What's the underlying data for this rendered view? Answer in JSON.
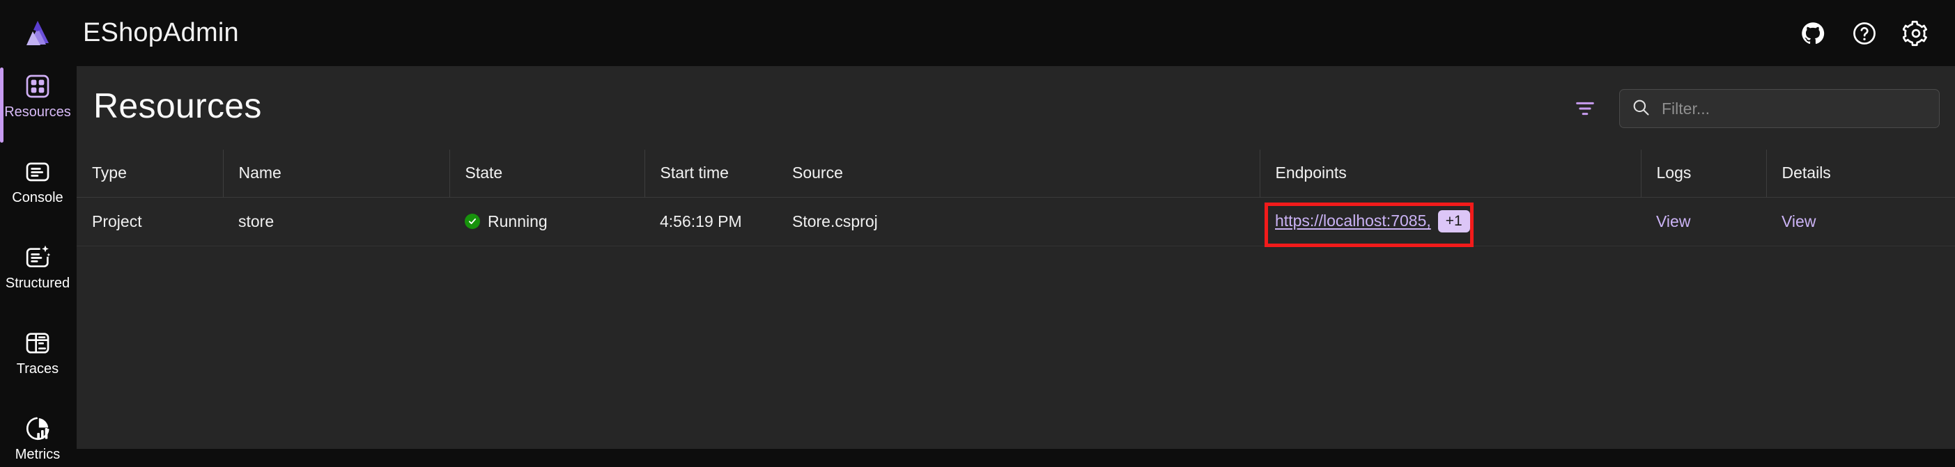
{
  "app": {
    "title": "EShopAdmin",
    "logo_icon": "aspire-logo-icon",
    "accent_color": "#c79bf0",
    "link_color": "#cbb3f5",
    "running_color": "#17920c",
    "highlight_color": "#f21b1b"
  },
  "topbar": {
    "actions": [
      {
        "name": "github-icon",
        "label": "GitHub"
      },
      {
        "name": "help-icon",
        "label": "Help"
      },
      {
        "name": "gear-icon",
        "label": "Settings"
      }
    ]
  },
  "sidebar": {
    "items": [
      {
        "label": "Resources",
        "icon": "grid-four-squares-icon",
        "active": true
      },
      {
        "label": "Console",
        "icon": "console-lines-icon",
        "active": false
      },
      {
        "label": "Structured",
        "icon": "structured-logs-sparkle-icon",
        "active": false
      },
      {
        "label": "Traces",
        "icon": "traces-gantt-icon",
        "active": false
      },
      {
        "label": "Metrics",
        "icon": "metrics-pie-chart-icon",
        "active": false
      }
    ]
  },
  "page": {
    "title": "Resources",
    "filter_toggle_icon": "filter-funnel-icon",
    "search": {
      "icon": "search-icon",
      "placeholder": "Filter...",
      "value": ""
    }
  },
  "table": {
    "columns": [
      "Type",
      "Name",
      "State",
      "Start time",
      "Source",
      "Endpoints",
      "Logs",
      "Details"
    ],
    "rows": [
      {
        "type": "Project",
        "name": "store",
        "state": "Running",
        "state_icon": "check-circle-icon",
        "start_time": "4:56:19 PM",
        "source": "Store.csproj",
        "endpoint_url": "https://localhost:7085,",
        "endpoint_more": "+1",
        "logs": "View",
        "details": "View"
      }
    ]
  },
  "annotation": {
    "target": "endpoints-cell",
    "style": "red-rectangle"
  }
}
